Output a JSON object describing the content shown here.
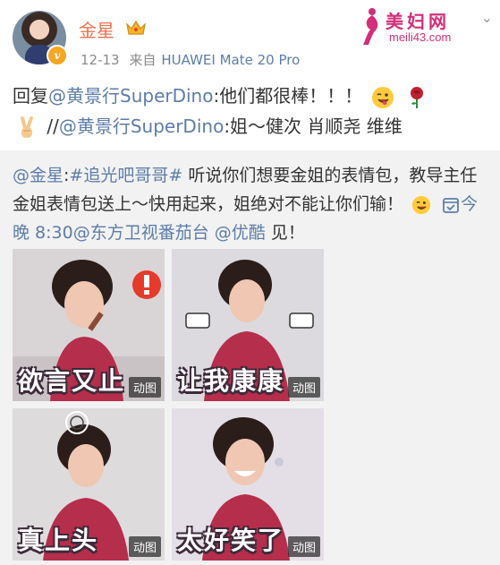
{
  "post": {
    "author": "金星",
    "timestamp": "12-13",
    "source_prefix": "来自",
    "source_device": "HUAWEI Mate 20 Pro",
    "reply_prefix": "回复",
    "reply_mention": "@黄景行SuperDino",
    "reply_text_1": ":他们都很棒！！！",
    "reply_separator": "//",
    "reply_mention_2": "@黄景行SuperDino",
    "reply_text_2": ":姐～健次 肖顺尧 维维"
  },
  "repost": {
    "author_mention": "@金星",
    "hashtag": "#追光吧哥哥#",
    "text": "听说你们想要金姐的表情包，教导主任金姐表情包送上～快用起来，姐绝对不能让你们输！",
    "schedule": "今晚 8:30",
    "channel_mention": "@东方卫视番茄台",
    "platform_mention": "@优酷",
    "closing": "见！"
  },
  "images": [
    {
      "caption": "欲言又止",
      "badge": "动图"
    },
    {
      "caption": "让我康康",
      "badge": "动图"
    },
    {
      "caption": "真上头",
      "badge": "动图"
    },
    {
      "caption": "太好笑了",
      "badge": "动图"
    }
  ],
  "watermark": {
    "title": "美妇网",
    "url": "meili43.com"
  },
  "icons": {
    "verified": "verified-badge-icon",
    "crown": "crown-icon",
    "wink_emoji": "wink-emoji-icon",
    "rose_emoji": "rose-emoji-icon",
    "victory_emoji": "victory-hand-emoji-icon",
    "calendar": "calendar-check-icon",
    "more": "chevron-down-icon"
  },
  "colors": {
    "username": "#eb7350",
    "link": "#5d7ca8",
    "watermark": "#d22e79",
    "repost_bg": "#f2f2f2"
  }
}
